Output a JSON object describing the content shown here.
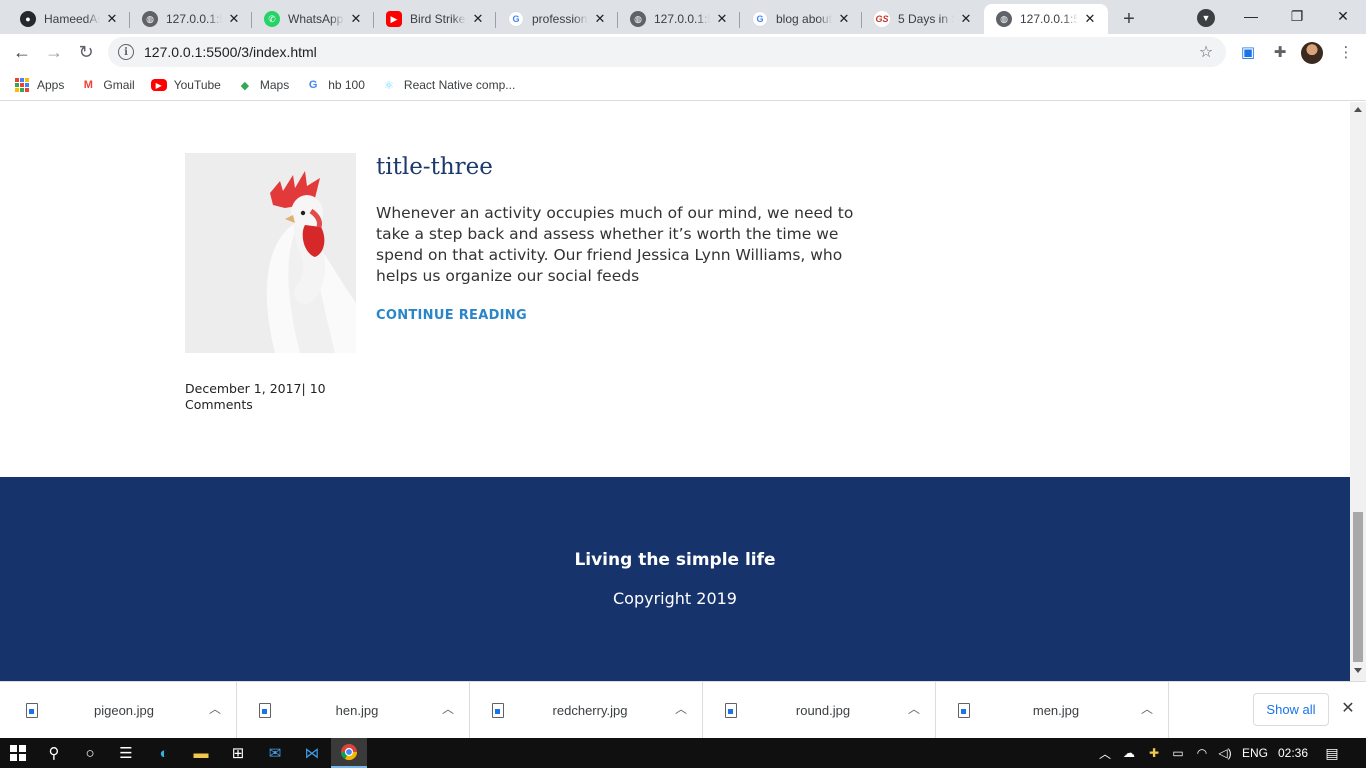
{
  "browser": {
    "tabs": [
      {
        "title": "HameedAs",
        "icon": "github-icon",
        "color": "#24292e"
      },
      {
        "title": "127.0.0.1:5",
        "icon": "globe-icon",
        "color": "#5f6368"
      },
      {
        "title": "WhatsApp",
        "icon": "whatsapp-icon",
        "color": "#25d366"
      },
      {
        "title": "Bird Strike",
        "icon": "youtube-icon",
        "color": "#ff0000"
      },
      {
        "title": "profession",
        "icon": "google-icon",
        "color": "#4285f4"
      },
      {
        "title": "127.0.0.1:5",
        "icon": "globe-icon",
        "color": "#5f6368"
      },
      {
        "title": "blog about",
        "icon": "google-icon",
        "color": "#4285f4"
      },
      {
        "title": "5 Days in S",
        "icon": "site-icon",
        "color": "#c0392b"
      },
      {
        "title": "127.0.0.1:5",
        "icon": "globe-icon",
        "color": "#5f6368",
        "active": true
      }
    ],
    "url": "127.0.0.1:5500/3/index.html",
    "bookmarks": [
      {
        "label": "Apps",
        "icon": "apps-icon"
      },
      {
        "label": "Gmail",
        "icon": "gmail-icon"
      },
      {
        "label": "YouTube",
        "icon": "youtube-icon"
      },
      {
        "label": "Maps",
        "icon": "maps-icon"
      },
      {
        "label": "hb 100",
        "icon": "google-icon"
      },
      {
        "label": "React Native comp...",
        "icon": "react-icon"
      }
    ]
  },
  "page": {
    "post": {
      "title": "title-three",
      "excerpt": "Whenever an activity occupies much of our mind, we need to take a step back and assess whether it’s worth the time we spend on that activity. Our friend Jessica Lynn Williams, who helps us organize our social feeds",
      "link": "CONTINUE READING",
      "meta": "December 1, 2017| 10 Comments"
    },
    "footer": {
      "title": "Living the simple life",
      "copyright": "Copyright 2019"
    }
  },
  "downloads": {
    "items": [
      "pigeon.jpg",
      "hen.jpg",
      "redcherry.jpg",
      "round.jpg",
      "men.jpg"
    ],
    "show_all": "Show all"
  },
  "taskbar": {
    "lang": "ENG",
    "time": "02:36"
  }
}
